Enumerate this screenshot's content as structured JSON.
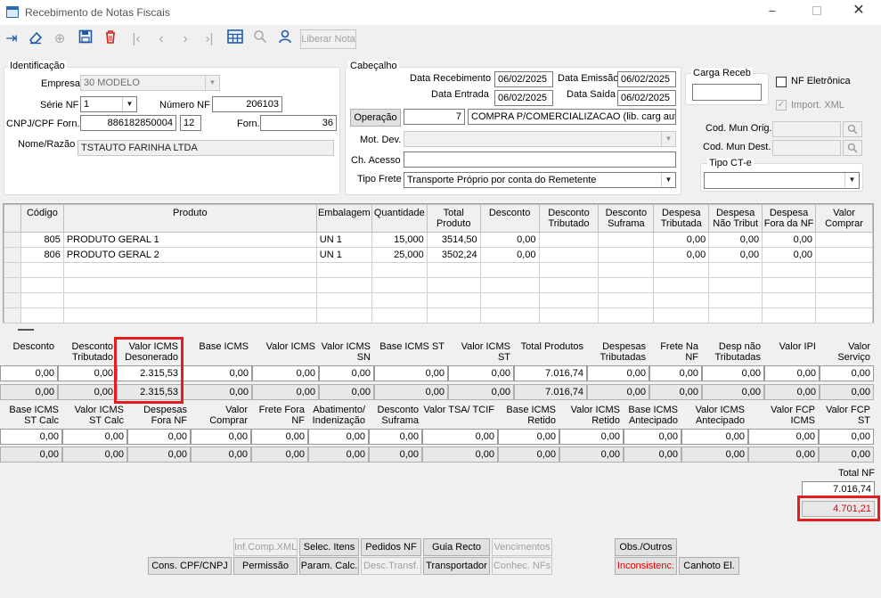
{
  "window": {
    "title": "Recebimento de Notas Fiscais"
  },
  "toolbar": {
    "liberar": "Liberar Nota",
    "icons": [
      "exit-icon",
      "eraser-icon",
      "add-icon",
      "save-icon",
      "delete-icon",
      "first-icon",
      "prev-icon",
      "next-icon",
      "last-icon",
      "grid-icon",
      "search-icon",
      "user-icon"
    ]
  },
  "ident": {
    "title": "Identificação",
    "empresa_lbl": "Empresa",
    "empresa": "30 MODELO",
    "serie_lbl": "Série NF",
    "serie": "1",
    "numero_lbl": "Número NF",
    "numero": "206103",
    "cnpj_lbl": "CNPJ/CPF Forn.",
    "cnpj": "886182850004",
    "cnpj2": "12",
    "forn_lbl": "Forn.",
    "forn": "36",
    "nome_lbl": "Nome/Razão",
    "nome": "TSTAUTO FARINHA LTDA"
  },
  "cab": {
    "title": "Cabeçalho",
    "data_receb_lbl": "Data Recebimento",
    "data_receb": "06/02/2025",
    "data_emis_lbl": "Data Emissão",
    "data_emis": "06/02/2025",
    "data_entr_lbl": "Data Entrada",
    "data_entr": "06/02/2025",
    "data_saida_lbl": "Data Saída",
    "data_saida": "06/02/2025",
    "operacao_btn": "Operação",
    "operacao_cod": "7",
    "operacao_desc": "COMPRA P/COMERCIALIZACAO (lib. carg autc",
    "motdev_lbl": "Mot. Dev.",
    "chacesso_lbl": "Ch. Acesso",
    "tipofrete_lbl": "Tipo Frete",
    "tipofrete": "Transporte Próprio por conta do Remetente"
  },
  "side": {
    "carga_lbl": "Carga Receb",
    "nfe_lbl": "NF Eletrônica",
    "import_lbl": "Import. XML",
    "mun_orig_lbl": "Cod. Mun Orig.",
    "mun_dest_lbl": "Cod. Mun Dest.",
    "tipocte_lbl": "Tipo CT-e"
  },
  "products": {
    "headers": [
      "Código",
      "Produto",
      "Embalagem",
      "Quantidade",
      "Total Produto",
      "Desconto",
      "Desconto Tributado",
      "Desconto Suframa",
      "Despesa Tributada",
      "Despesa Não Tribut",
      "Despesa Fora da NF",
      "Valor Comprar"
    ],
    "rows": [
      {
        "codigo": "805",
        "produto": "PRODUTO GERAL 1",
        "emb": "UN  1",
        "qtd": "15,000",
        "total": "3514,50",
        "desc": "0,00",
        "desp_trib": "0,00",
        "desp_ntrib": "0,00",
        "desp_fora": "0,00"
      },
      {
        "codigo": "806",
        "produto": "PRODUTO GERAL 2",
        "emb": "UN  1",
        "qtd": "25,000",
        "total": "3502,24",
        "desc": "0,00",
        "desp_trib": "0,00",
        "desp_ntrib": "0,00",
        "desp_fora": "0,00"
      }
    ]
  },
  "totals1": {
    "headers": [
      "Desconto",
      "Desconto Tributado",
      "Valor ICMS Desonerado",
      "Base ICMS",
      "Valor ICMS",
      "Valor ICMS SN",
      "Base ICMS ST",
      "Valor ICMS ST",
      "Total Produtos",
      "Despesas Tributadas",
      "Frete Na NF",
      "Desp não Tributadas",
      "Valor IPI",
      "Valor Serviço"
    ],
    "row1": [
      "0,00",
      "0,00",
      "2.315,53",
      "0,00",
      "0,00",
      "0,00",
      "0,00",
      "0,00",
      "7.016,74",
      "0,00",
      "0,00",
      "0,00",
      "0,00",
      "0,00"
    ],
    "row2": [
      "0,00",
      "0,00",
      "2.315,53",
      "0,00",
      "0,00",
      "0,00",
      "0,00",
      "0,00",
      "7.016,74",
      "0,00",
      "0,00",
      "0,00",
      "0,00",
      "0,00"
    ]
  },
  "totals2": {
    "headers": [
      "Base ICMS ST Calc",
      "Valor ICMS ST Calc",
      "Despesas Fora NF",
      "Valor Comprar",
      "Frete Fora NF",
      "Abatimento/ Indenização",
      "Desconto Suframa",
      "Valor TSA/ TCIF",
      "Base ICMS Retido",
      "Valor ICMS Retido",
      "Base ICMS Antecipado",
      "Valor ICMS Antecipado",
      "Valor FCP ICMS",
      "Valor FCP ST"
    ],
    "row1": [
      "0,00",
      "0,00",
      "0,00",
      "0,00",
      "0,00",
      "0,00",
      "0,00",
      "0,00",
      "0,00",
      "0,00",
      "0,00",
      "0,00",
      "0,00",
      "0,00"
    ],
    "row2": [
      "0,00",
      "0,00",
      "0,00",
      "0,00",
      "0,00",
      "0,00",
      "0,00",
      "0,00",
      "0,00",
      "0,00",
      "0,00",
      "0,00",
      "0,00",
      "0,00"
    ]
  },
  "total_nf": {
    "label": "Total NF",
    "value": "7.016,74",
    "value2": "4.701,21"
  },
  "buttons": {
    "infcomp": "Inf.Comp.XML",
    "selec": "Selec. Itens",
    "pedidos": "Pedidos NF",
    "guia": "Guia Recto",
    "venc": "Vencimentos",
    "obs": "Obs./Outros",
    "cons": "Cons. CPF/CNPJ",
    "perm": "Permissão",
    "param": "Param. Calc.",
    "desct": "Desc.Transf.",
    "transp": "Transportador",
    "conhec": "Conhec. NFs",
    "incons": "Inconsistenc.",
    "canhoto": "Canhoto El."
  },
  "colors": {
    "highlight": "#e41e1e",
    "inconsist": "#e00000"
  }
}
